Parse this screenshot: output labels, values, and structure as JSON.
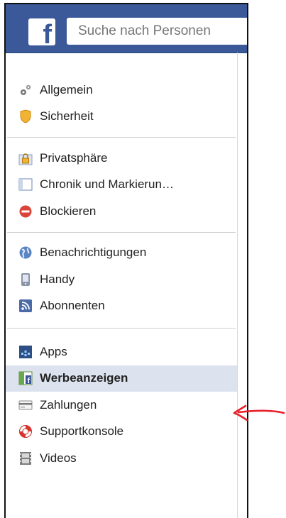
{
  "header": {
    "search_placeholder": "Suche nach Personen"
  },
  "sidebar": {
    "groups": [
      {
        "items": [
          {
            "label": "Allgemein",
            "icon": "gears-icon"
          },
          {
            "label": "Sicherheit",
            "icon": "shield-icon"
          }
        ]
      },
      {
        "items": [
          {
            "label": "Privatsphäre",
            "icon": "lock-icon"
          },
          {
            "label": "Chronik und Markierun…",
            "icon": "timeline-icon"
          },
          {
            "label": "Blockieren",
            "icon": "block-icon"
          }
        ]
      },
      {
        "items": [
          {
            "label": "Benachrichtigungen",
            "icon": "globe-icon"
          },
          {
            "label": "Handy",
            "icon": "phone-icon"
          },
          {
            "label": "Abonnenten",
            "icon": "rss-icon"
          }
        ]
      },
      {
        "items": [
          {
            "label": "Apps",
            "icon": "apps-icon"
          },
          {
            "label": "Werbeanzeigen",
            "icon": "ads-icon",
            "active": true
          },
          {
            "label": "Zahlungen",
            "icon": "card-icon"
          },
          {
            "label": "Supportkonsole",
            "icon": "lifebuoy-icon"
          },
          {
            "label": "Videos",
            "icon": "film-icon"
          }
        ]
      }
    ]
  },
  "colors": {
    "brand": "#3b5998",
    "active_row": "#dde3ee",
    "annotation_arrow": "#e8202a"
  }
}
